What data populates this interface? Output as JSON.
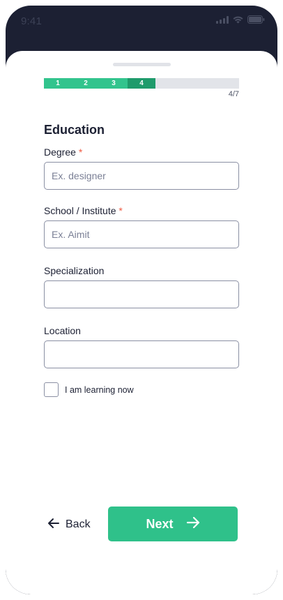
{
  "status_bar": {
    "time": "9:41"
  },
  "progress": {
    "steps": [
      "1",
      "2",
      "3",
      "4"
    ],
    "current_step": 4,
    "total_steps": 7,
    "counter": "4/7",
    "colors": {
      "done": "#32c48d",
      "current": "#1f9b6b",
      "track": "#e2e4e9"
    }
  },
  "form": {
    "title": "Education",
    "required_marker": "*",
    "fields": {
      "degree": {
        "label": "Degree",
        "placeholder": "Ex. designer",
        "value": ""
      },
      "school": {
        "label": "School / Institute",
        "placeholder": "Ex. Aimit",
        "value": ""
      },
      "specialization": {
        "label": "Specialization",
        "placeholder": "",
        "value": ""
      },
      "location": {
        "label": "Location",
        "placeholder": "",
        "value": ""
      }
    },
    "learning_checkbox": {
      "label": "I am learning now",
      "checked": false
    }
  },
  "actions": {
    "back_label": "Back",
    "next_label": "Next",
    "accent": "#2fc18a"
  },
  "icons": {
    "back": "arrow-left-icon",
    "next": "arrow-right-icon",
    "signal": "cellular-signal-icon",
    "wifi": "wifi-icon",
    "battery": "battery-icon"
  }
}
